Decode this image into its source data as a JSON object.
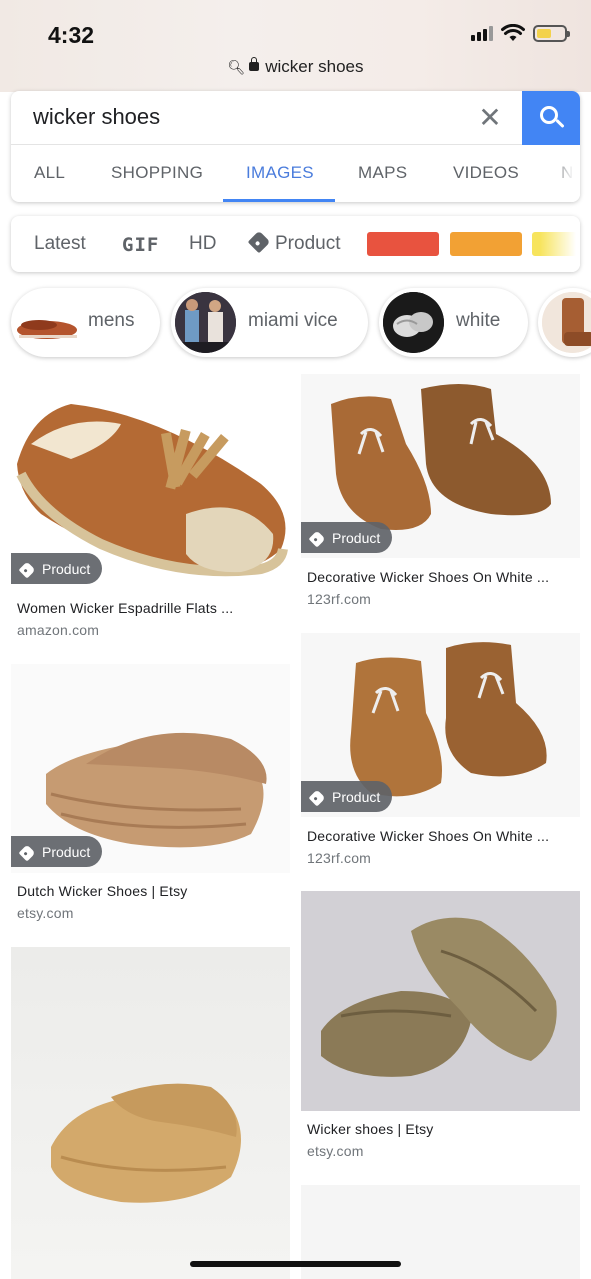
{
  "status_bar": {
    "time": "4:32"
  },
  "url_bar": {
    "text": "wicker shoes"
  },
  "search": {
    "query": "wicker shoes"
  },
  "tabs": [
    {
      "label": "ALL"
    },
    {
      "label": "SHOPPING"
    },
    {
      "label": "IMAGES",
      "active": true
    },
    {
      "label": "MAPS"
    },
    {
      "label": "VIDEOS"
    },
    {
      "label": "NE"
    }
  ],
  "filters": {
    "latest": "Latest",
    "gif": "GIF",
    "hd": "HD",
    "product": "Product",
    "colors": [
      "#e8533f",
      "#f2a134",
      "#f7e45d"
    ]
  },
  "chips": [
    {
      "label": "mens"
    },
    {
      "label": "miami vice"
    },
    {
      "label": "white"
    }
  ],
  "results": [
    {
      "title": "Women Wicker Espadrille Flats ...",
      "source": "amazon.com",
      "badge": "Product"
    },
    {
      "title": "Decorative Wicker Shoes On White ...",
      "source": "123rf.com",
      "badge": "Product"
    },
    {
      "title": "Dutch Wicker Shoes | Etsy",
      "source": "etsy.com",
      "badge": "Product"
    },
    {
      "title": "Decorative Wicker Shoes On White ...",
      "source": "123rf.com",
      "badge": "Product"
    },
    {
      "title": "Wicker shoes | Etsy",
      "source": "etsy.com"
    }
  ],
  "colors": {
    "accent": "#4285f4",
    "active_tab": "#4a7cdc",
    "badge_bg": "#5f6368"
  }
}
